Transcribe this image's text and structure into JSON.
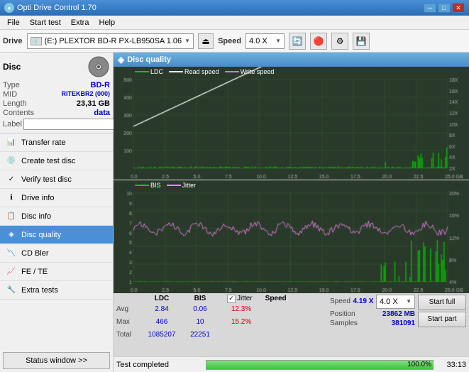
{
  "app": {
    "title": "Opti Drive Control 1.70",
    "icon": "●"
  },
  "titlebar": {
    "minimize": "─",
    "maximize": "□",
    "close": "✕"
  },
  "menu": {
    "items": [
      "File",
      "Start test",
      "Extra",
      "Help"
    ]
  },
  "toolbar": {
    "drive_label": "Drive",
    "drive_name": "(E:)  PLEXTOR BD-R  PX-LB950SA 1.06",
    "speed_label": "Speed",
    "speed_value": "4.0 X",
    "eject_icon": "⏏"
  },
  "disc": {
    "label": "Disc",
    "type_key": "Type",
    "type_value": "BD-R",
    "mid_key": "MID",
    "mid_value": "RITEKBR2 (000)",
    "length_key": "Length",
    "length_value": "23,31 GB",
    "contents_key": "Contents",
    "contents_value": "data",
    "label_key": "Label",
    "label_placeholder": ""
  },
  "nav": {
    "items": [
      {
        "id": "transfer-rate",
        "label": "Transfer rate",
        "icon": "📊"
      },
      {
        "id": "create-test-disc",
        "label": "Create test disc",
        "icon": "💿"
      },
      {
        "id": "verify-test-disc",
        "label": "Verify test disc",
        "icon": "✓"
      },
      {
        "id": "drive-info",
        "label": "Drive info",
        "icon": "ℹ"
      },
      {
        "id": "disc-info",
        "label": "Disc info",
        "icon": "📋"
      },
      {
        "id": "disc-quality",
        "label": "Disc quality",
        "icon": "◈",
        "active": true
      },
      {
        "id": "cd-bler",
        "label": "CD Bler",
        "icon": "📉"
      },
      {
        "id": "fe-te",
        "label": "FE / TE",
        "icon": "📈"
      },
      {
        "id": "extra-tests",
        "label": "Extra tests",
        "icon": "🔧"
      }
    ],
    "status_btn": "Status window >>"
  },
  "quality_panel": {
    "title": "Disc quality",
    "icon": "◈"
  },
  "chart_top": {
    "legend": [
      {
        "label": "LDC",
        "color": "#00aa00"
      },
      {
        "label": "Read speed",
        "color": "#ffffff"
      },
      {
        "label": "Write speed",
        "color": "#ff66ff"
      }
    ],
    "y_right": [
      "18X",
      "16X",
      "14X",
      "12X",
      "10X",
      "8X",
      "6X",
      "4X",
      "2X"
    ],
    "y_left": [
      "500",
      "400",
      "300",
      "200",
      "100"
    ],
    "x_labels": [
      "0.0",
      "2.5",
      "5.0",
      "7.5",
      "10.0",
      "12.5",
      "15.0",
      "17.5",
      "20.0",
      "22.5",
      "25.0 GB"
    ]
  },
  "chart_bottom": {
    "legend": [
      {
        "label": "BIS",
        "color": "#00aa00"
      },
      {
        "label": "Jitter",
        "color": "#ff88ff"
      }
    ],
    "y_right": [
      "20%",
      "16%",
      "12%",
      "8%",
      "4%"
    ],
    "y_left": [
      "10",
      "9",
      "8",
      "7",
      "6",
      "5",
      "4",
      "3",
      "2",
      "1"
    ],
    "x_labels": [
      "0.0",
      "2.5",
      "5.0",
      "7.5",
      "10.0",
      "12.5",
      "15.0",
      "17.5",
      "20.0",
      "22.5",
      "25.0 GB"
    ]
  },
  "stats": {
    "columns": [
      "LDC",
      "BIS",
      "",
      "Jitter",
      "Speed"
    ],
    "jitter_checked": true,
    "jitter_label": "Jitter",
    "speed_value": "4.19 X",
    "speed_box_value": "4.0 X",
    "rows": [
      {
        "label": "Avg",
        "ldc": "2.84",
        "bis": "0.06",
        "jitter": "12.3%"
      },
      {
        "label": "Max",
        "ldc": "466",
        "bis": "10",
        "jitter": "15.2%"
      },
      {
        "label": "Total",
        "ldc": "1085207",
        "bis": "22251",
        "jitter": ""
      }
    ],
    "position_label": "Position",
    "position_value": "23862 MB",
    "samples_label": "Samples",
    "samples_value": "381091",
    "start_full": "Start full",
    "start_part": "Start part"
  },
  "statusbar": {
    "text": "Test completed",
    "progress": 100,
    "progress_text": "100.0%",
    "time": "33:13"
  }
}
